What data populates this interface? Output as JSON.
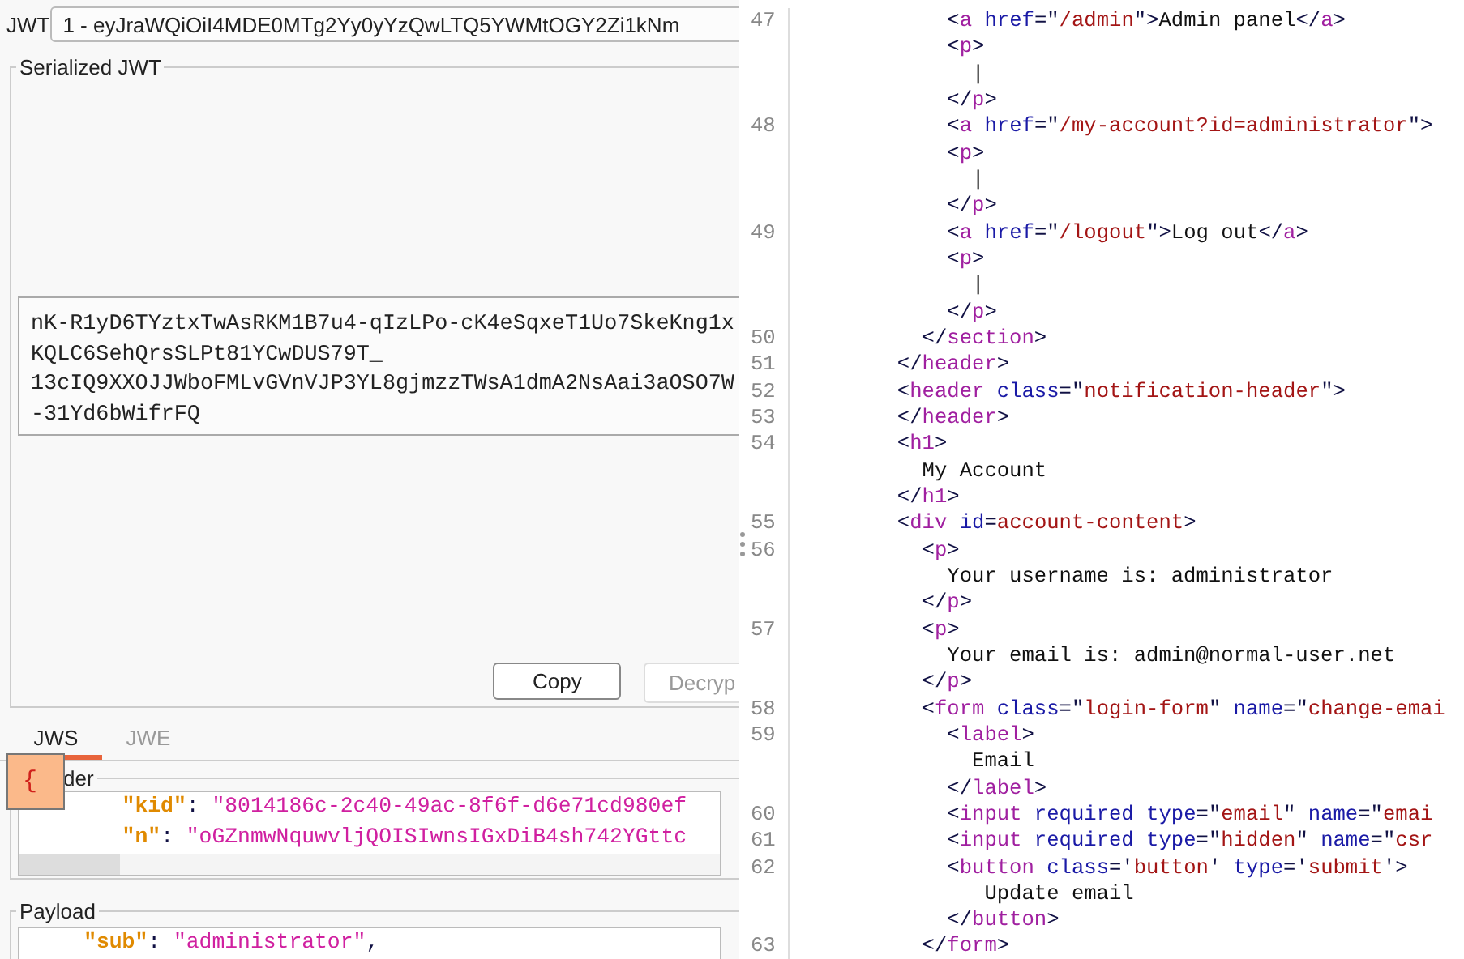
{
  "jwt_selector": {
    "label": "JWT",
    "value": "1 - eyJraWQiOiI4MDE0MTg2Yy0yYzQwLTQ5YWMtOGY2Zi1kNm"
  },
  "serialized_jwt": {
    "title": "Serialized JWT",
    "lines": [
      "nK-R1yD6TYztxTwAsRKM1B7u4-qIzLPo-cK4eSqxeT1Uo7SkeKng1x",
      "KQLC6SehQrsSLPt81YCwDUS79T_",
      "13cIQ9XXOJJWboFMLvGVnVJP3YL8gjmzzTWsA1dmA2NsAai3aOSO7W",
      "-31Yd6bWifrFQ"
    ],
    "buttons": [
      {
        "label": "Copy",
        "disabled": false
      },
      {
        "label": "Decryp",
        "disabled": true
      }
    ]
  },
  "tabs": [
    {
      "label": "JWS",
      "selected": true
    },
    {
      "label": "JWE",
      "selected": false
    }
  ],
  "header": {
    "title": "der",
    "popup": "{",
    "lines": [
      [
        {
          "kind": "key",
          "text": "        \"kid\""
        },
        {
          "kind": "p",
          "text": ": "
        },
        {
          "kind": "str",
          "text": "\"8014186c-2c40-49ac-8f6f-d6e71cd980ef"
        }
      ],
      [
        {
          "kind": "key",
          "text": "        \"n\""
        },
        {
          "kind": "p",
          "text": ": "
        },
        {
          "kind": "str",
          "text": "\"oGZnmwNquwvljQOISIwnsIGxDiB4sh742YGttc"
        }
      ]
    ]
  },
  "payload": {
    "title": "Payload",
    "lines": [
      [
        {
          "kind": "key",
          "text": "     \"sub\""
        },
        {
          "kind": "p",
          "text": ": "
        },
        {
          "kind": "str",
          "text": "\"administrator\""
        },
        {
          "kind": "p",
          "text": ","
        }
      ]
    ]
  },
  "code_lines": [
    {
      "number": "47",
      "tokens": [
        {
          "kind": "p",
          "text": "            <"
        },
        {
          "kind": "tag",
          "text": "a"
        },
        {
          "kind": "attr",
          "text": " href"
        },
        {
          "kind": "p",
          "text": "=\""
        },
        {
          "kind": "val",
          "text": "/admin"
        },
        {
          "kind": "p",
          "text": "\">"
        },
        {
          "kind": "txt",
          "text": "Admin panel"
        },
        {
          "kind": "p",
          "text": "</"
        },
        {
          "kind": "tag",
          "text": "a"
        },
        {
          "kind": "p",
          "text": ">"
        }
      ]
    },
    {
      "tokens": [
        {
          "kind": "p",
          "text": "            <"
        },
        {
          "kind": "tag",
          "text": "p"
        },
        {
          "kind": "p",
          "text": ">"
        }
      ]
    },
    {
      "tokens": [
        {
          "kind": "txt",
          "text": "              |"
        }
      ]
    },
    {
      "tokens": [
        {
          "kind": "p",
          "text": "            </"
        },
        {
          "kind": "tag",
          "text": "p"
        },
        {
          "kind": "p",
          "text": ">"
        }
      ]
    },
    {
      "number": "48",
      "tokens": [
        {
          "kind": "p",
          "text": "            <"
        },
        {
          "kind": "tag",
          "text": "a"
        },
        {
          "kind": "attr",
          "text": " href"
        },
        {
          "kind": "p",
          "text": "=\""
        },
        {
          "kind": "val",
          "text": "/my-account?id=administrator"
        },
        {
          "kind": "p",
          "text": "\">"
        }
      ]
    },
    {
      "tokens": [
        {
          "kind": "p",
          "text": "            <"
        },
        {
          "kind": "tag",
          "text": "p"
        },
        {
          "kind": "p",
          "text": ">"
        }
      ]
    },
    {
      "tokens": [
        {
          "kind": "txt",
          "text": "              |"
        }
      ]
    },
    {
      "tokens": [
        {
          "kind": "p",
          "text": "            </"
        },
        {
          "kind": "tag",
          "text": "p"
        },
        {
          "kind": "p",
          "text": ">"
        }
      ]
    },
    {
      "number": "49",
      "tokens": [
        {
          "kind": "p",
          "text": "            <"
        },
        {
          "kind": "tag",
          "text": "a"
        },
        {
          "kind": "attr",
          "text": " href"
        },
        {
          "kind": "p",
          "text": "=\""
        },
        {
          "kind": "val",
          "text": "/logout"
        },
        {
          "kind": "p",
          "text": "\">"
        },
        {
          "kind": "txt",
          "text": "Log out"
        },
        {
          "kind": "p",
          "text": "</"
        },
        {
          "kind": "tag",
          "text": "a"
        },
        {
          "kind": "p",
          "text": ">"
        }
      ]
    },
    {
      "tokens": [
        {
          "kind": "p",
          "text": "            <"
        },
        {
          "kind": "tag",
          "text": "p"
        },
        {
          "kind": "p",
          "text": ">"
        }
      ]
    },
    {
      "tokens": [
        {
          "kind": "txt",
          "text": "              |"
        }
      ]
    },
    {
      "tokens": [
        {
          "kind": "p",
          "text": "            </"
        },
        {
          "kind": "tag",
          "text": "p"
        },
        {
          "kind": "p",
          "text": ">"
        }
      ]
    },
    {
      "number": "50",
      "tokens": [
        {
          "kind": "p",
          "text": "          </"
        },
        {
          "kind": "tag",
          "text": "section"
        },
        {
          "kind": "p",
          "text": ">"
        }
      ]
    },
    {
      "number": "51",
      "tokens": [
        {
          "kind": "p",
          "text": "        </"
        },
        {
          "kind": "tag",
          "text": "header"
        },
        {
          "kind": "p",
          "text": ">"
        }
      ]
    },
    {
      "number": "52",
      "tokens": [
        {
          "kind": "p",
          "text": "        <"
        },
        {
          "kind": "tag",
          "text": "header"
        },
        {
          "kind": "attr",
          "text": " class"
        },
        {
          "kind": "p",
          "text": "=\""
        },
        {
          "kind": "val",
          "text": "notification-header"
        },
        {
          "kind": "p",
          "text": "\">"
        }
      ]
    },
    {
      "number": "53",
      "tokens": [
        {
          "kind": "p",
          "text": "        </"
        },
        {
          "kind": "tag",
          "text": "header"
        },
        {
          "kind": "p",
          "text": ">"
        }
      ]
    },
    {
      "number": "54",
      "tokens": [
        {
          "kind": "p",
          "text": "        <"
        },
        {
          "kind": "tag",
          "text": "h1"
        },
        {
          "kind": "p",
          "text": ">"
        }
      ]
    },
    {
      "tokens": [
        {
          "kind": "txt",
          "text": "          My Account"
        }
      ]
    },
    {
      "tokens": [
        {
          "kind": "p",
          "text": "        </"
        },
        {
          "kind": "tag",
          "text": "h1"
        },
        {
          "kind": "p",
          "text": ">"
        }
      ]
    },
    {
      "number": "55",
      "tokens": [
        {
          "kind": "p",
          "text": "        <"
        },
        {
          "kind": "tag",
          "text": "div"
        },
        {
          "kind": "attr",
          "text": " id"
        },
        {
          "kind": "p",
          "text": "="
        },
        {
          "kind": "val",
          "text": "account-content"
        },
        {
          "kind": "p",
          "text": ">"
        }
      ]
    },
    {
      "number": "56",
      "tokens": [
        {
          "kind": "p",
          "text": "          <"
        },
        {
          "kind": "tag",
          "text": "p"
        },
        {
          "kind": "p",
          "text": ">"
        }
      ]
    },
    {
      "tokens": [
        {
          "kind": "txt",
          "text": "            Your username is: administrator"
        }
      ]
    },
    {
      "tokens": [
        {
          "kind": "p",
          "text": "          </"
        },
        {
          "kind": "tag",
          "text": "p"
        },
        {
          "kind": "p",
          "text": ">"
        }
      ]
    },
    {
      "number": "57",
      "tokens": [
        {
          "kind": "p",
          "text": "          <"
        },
        {
          "kind": "tag",
          "text": "p"
        },
        {
          "kind": "p",
          "text": ">"
        }
      ]
    },
    {
      "tokens": [
        {
          "kind": "txt",
          "text": "            Your email is: admin@normal-user.net"
        }
      ]
    },
    {
      "tokens": [
        {
          "kind": "p",
          "text": "          </"
        },
        {
          "kind": "tag",
          "text": "p"
        },
        {
          "kind": "p",
          "text": ">"
        }
      ]
    },
    {
      "number": "58",
      "tokens": [
        {
          "kind": "p",
          "text": "          <"
        },
        {
          "kind": "tag",
          "text": "form"
        },
        {
          "kind": "attr",
          "text": " class"
        },
        {
          "kind": "p",
          "text": "=\""
        },
        {
          "kind": "val",
          "text": "login-form"
        },
        {
          "kind": "p",
          "text": "\""
        },
        {
          "kind": "attr",
          "text": " name"
        },
        {
          "kind": "p",
          "text": "=\""
        },
        {
          "kind": "val",
          "text": "change-emai"
        }
      ]
    },
    {
      "number": "59",
      "tokens": [
        {
          "kind": "p",
          "text": "            <"
        },
        {
          "kind": "tag",
          "text": "label"
        },
        {
          "kind": "p",
          "text": ">"
        }
      ]
    },
    {
      "tokens": [
        {
          "kind": "txt",
          "text": "              Email"
        }
      ]
    },
    {
      "tokens": [
        {
          "kind": "p",
          "text": "            </"
        },
        {
          "kind": "tag",
          "text": "label"
        },
        {
          "kind": "p",
          "text": ">"
        }
      ]
    },
    {
      "number": "60",
      "tokens": [
        {
          "kind": "p",
          "text": "            <"
        },
        {
          "kind": "tag",
          "text": "input"
        },
        {
          "kind": "attr",
          "text": " required type"
        },
        {
          "kind": "p",
          "text": "=\""
        },
        {
          "kind": "val",
          "text": "email"
        },
        {
          "kind": "p",
          "text": "\""
        },
        {
          "kind": "attr",
          "text": " name"
        },
        {
          "kind": "p",
          "text": "=\""
        },
        {
          "kind": "val",
          "text": "emai"
        }
      ]
    },
    {
      "number": "61",
      "tokens": [
        {
          "kind": "p",
          "text": "            <"
        },
        {
          "kind": "tag",
          "text": "input"
        },
        {
          "kind": "attr",
          "text": " required type"
        },
        {
          "kind": "p",
          "text": "=\""
        },
        {
          "kind": "val",
          "text": "hidden"
        },
        {
          "kind": "p",
          "text": "\""
        },
        {
          "kind": "attr",
          "text": " name"
        },
        {
          "kind": "p",
          "text": "=\""
        },
        {
          "kind": "val",
          "text": "csr"
        }
      ]
    },
    {
      "number": "62",
      "tokens": [
        {
          "kind": "p",
          "text": "            <"
        },
        {
          "kind": "tag",
          "text": "button"
        },
        {
          "kind": "attr",
          "text": " class"
        },
        {
          "kind": "p",
          "text": "='"
        },
        {
          "kind": "val",
          "text": "button"
        },
        {
          "kind": "p",
          "text": "'"
        },
        {
          "kind": "attr",
          "text": " type"
        },
        {
          "kind": "p",
          "text": "='"
        },
        {
          "kind": "val",
          "text": "submit"
        },
        {
          "kind": "p",
          "text": "'>"
        }
      ]
    },
    {
      "tokens": [
        {
          "kind": "txt",
          "text": "               Update email"
        }
      ]
    },
    {
      "tokens": [
        {
          "kind": "p",
          "text": "            </"
        },
        {
          "kind": "tag",
          "text": "button"
        },
        {
          "kind": "p",
          "text": ">"
        }
      ]
    },
    {
      "number": "63",
      "tokens": [
        {
          "kind": "p",
          "text": "          </"
        },
        {
          "kind": "tag",
          "text": "form"
        },
        {
          "kind": "p",
          "text": ">"
        }
      ]
    }
  ]
}
